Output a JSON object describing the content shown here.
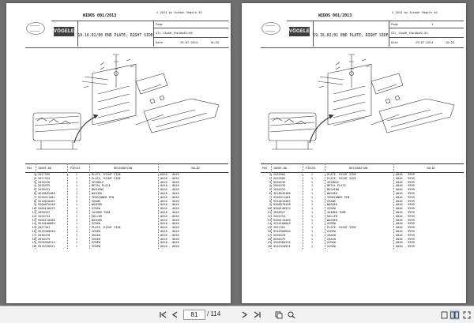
{
  "document": {
    "title": "WIDOS 001/2013",
    "copyright": "© 2013 by Joseph Vögele AG",
    "logo_text": "VÖGELE",
    "field_labels": {
      "page": "Page",
      "date": "Date"
    },
    "table_headers": [
      "POS",
      "IDENT-NO",
      "PIECES",
      "DESIGNATION",
      "VALID"
    ]
  },
  "pages": [
    {
      "part_title": "19.16.02/00 END PLATE, RIGHT SIDE",
      "doc_ref": "STL_13pAB_19p16p02-00",
      "page_no": "",
      "date": "29.07.2014",
      "time": "10:25",
      "rows": [
        {
          "pos": "1",
          "id": "2027399",
          "pcs": "1",
          "des": "PLATE, RIGHT SIDE",
          "valid": "0018 - 0045"
        },
        {
          "pos": "2",
          "id": "2027354",
          "pcs": "1",
          "des": "PLATE, RIGHT SIDE",
          "valid": "0018 - 0045"
        },
        {
          "pos": "3",
          "id": "2030336",
          "pcs": "1",
          "des": "SPINDLE",
          "valid": "0018 - 0045"
        },
        {
          "pos": "4",
          "id": "2030335",
          "pcs": "1",
          "des": "METAL PLATE",
          "valid": "0018 - 0045"
        },
        {
          "pos": "5",
          "id": "2030333",
          "pcs": "1",
          "des": "BUSHING",
          "valid": "0018 - 0045"
        },
        {
          "pos": "6",
          "id": "4618042488",
          "pcs": "1",
          "des": "WASHER",
          "valid": "0018 - 0045"
        },
        {
          "pos": "7",
          "id": "9530311481",
          "pcs": "1",
          "des": "TENSIONER PIN",
          "valid": "0018 - 0045"
        },
        {
          "pos": "8",
          "id": "9510010465",
          "pcs": "1",
          "des": "CRANK",
          "valid": "0018 - 0045"
        },
        {
          "pos": "9",
          "id": "9500070448",
          "pcs": "1",
          "des": "WASHER",
          "valid": "0018 - 0045"
        },
        {
          "pos": "10",
          "id": "9500140933",
          "pcs": "1",
          "des": "SCREW",
          "valid": "0018 - 0045"
        },
        {
          "pos": "11",
          "id": "2030327",
          "pcs": "1",
          "des": "JOINED TUBE",
          "valid": "0018 - 0045"
        },
        {
          "pos": "12",
          "id": "2026754",
          "pcs": "1",
          "des": "ROLLER",
          "valid": "0018 - 0045"
        },
        {
          "pos": "13",
          "id": "9500110468",
          "pcs": "1",
          "des": "WASHER",
          "valid": "0018 - 0045"
        },
        {
          "pos": "14",
          "id": "9510100869",
          "pcs": "1",
          "des": "SCREW",
          "valid": "0018 - 0045"
        },
        {
          "pos": "15",
          "id": "2027361",
          "pcs": "1",
          "des": "PLATE, RIGHT SIDE",
          "valid": "0018 - 0045"
        },
        {
          "pos": "16",
          "id": "9510300940",
          "pcs": "1",
          "des": "SCREW",
          "valid": "0018 - 0045"
        },
        {
          "pos": "17",
          "id": "2030478",
          "pcs": "1",
          "des": "CHAIN",
          "valid": "0018 - 0045"
        },
        {
          "pos": "18",
          "id": "2030479",
          "pcs": "1",
          "des": "CHAIN",
          "valid": "0018 - 0045"
        },
        {
          "pos": "19",
          "id": "9598300314",
          "pcs": "1",
          "des": "SCREW",
          "valid": "0018 - 0045"
        },
        {
          "pos": "20",
          "id": "9516326921",
          "pcs": "1",
          "des": "SCREW",
          "valid": "0018 - 0045"
        }
      ]
    },
    {
      "part_title": "19.16.02/01 END PLATE, RIGHT SIDE",
      "doc_ref": "STL_13pAB_19p16p02-01",
      "page_no": "1",
      "date": "29.07.2014",
      "time": "10:25",
      "rows": [
        {
          "pos": "1",
          "id": "2035984",
          "pcs": "1",
          "des": "PLATE, RIGHT SIDE",
          "valid": "0046 - 9999"
        },
        {
          "pos": "2",
          "id": "2035985",
          "pcs": "1",
          "des": "PLATE, RIGHT SIDE",
          "valid": "0046 - 9999"
        },
        {
          "pos": "3",
          "id": "2030336",
          "pcs": "1",
          "des": "SPINDLE",
          "valid": "0046 - 9999"
        },
        {
          "pos": "4",
          "id": "2030335",
          "pcs": "1",
          "des": "METAL PLATE",
          "valid": "0046 - 9999"
        },
        {
          "pos": "5",
          "id": "2030333",
          "pcs": "1",
          "des": "BUSHING",
          "valid": "0046 - 9999"
        },
        {
          "pos": "6",
          "id": "4618042488",
          "pcs": "1",
          "des": "WASHER",
          "valid": "0046 - 9999"
        },
        {
          "pos": "7",
          "id": "9530311481",
          "pcs": "1",
          "des": "TENSIONER PIN",
          "valid": "0046 - 9999"
        },
        {
          "pos": "8",
          "id": "9510010465",
          "pcs": "1",
          "des": "CRANK",
          "valid": "0046 - 9999"
        },
        {
          "pos": "9",
          "id": "9500070448",
          "pcs": "1",
          "des": "WASHER",
          "valid": "0046 - 9999"
        },
        {
          "pos": "10",
          "id": "9500140933",
          "pcs": "1",
          "des": "SCREW",
          "valid": "0046 - 9999"
        },
        {
          "pos": "11",
          "id": "2030327",
          "pcs": "1",
          "des": "JOINED TUBE",
          "valid": "0046 - 9999"
        },
        {
          "pos": "12",
          "id": "2026754",
          "pcs": "1",
          "des": "ROLLER",
          "valid": "0046 - 9999"
        },
        {
          "pos": "13",
          "id": "9500110468",
          "pcs": "1",
          "des": "WASHER",
          "valid": "0046 - 9999"
        },
        {
          "pos": "14",
          "id": "9510100869",
          "pcs": "1",
          "des": "SCREW",
          "valid": "0046 - 9999"
        },
        {
          "pos": "15",
          "id": "2027361",
          "pcs": "1",
          "des": "PLATE, RIGHT SIDE",
          "valid": "0046 - 9999"
        },
        {
          "pos": "16",
          "id": "9510300940",
          "pcs": "1",
          "des": "SCREW",
          "valid": "0046 - 9999"
        },
        {
          "pos": "17",
          "id": "2030478",
          "pcs": "1",
          "des": "CHAIN",
          "valid": "0046 - 9999"
        },
        {
          "pos": "18",
          "id": "2030479",
          "pcs": "1",
          "des": "CHAIN",
          "valid": "0046 - 9999"
        },
        {
          "pos": "19",
          "id": "9598300314",
          "pcs": "1",
          "des": "SCREW",
          "valid": "0046 - 9999"
        },
        {
          "pos": "20",
          "id": "9516326921",
          "pcs": "1",
          "des": "SCREW",
          "valid": "0046 - 9999"
        }
      ]
    }
  ],
  "toolbar": {
    "current_page": "81",
    "total_pages": "/ 114"
  },
  "colors": {
    "viewer_bg": "#6f6f6f",
    "toolbar_bg": "#f2f2f2",
    "logo_bg": "#3d3d3d"
  }
}
